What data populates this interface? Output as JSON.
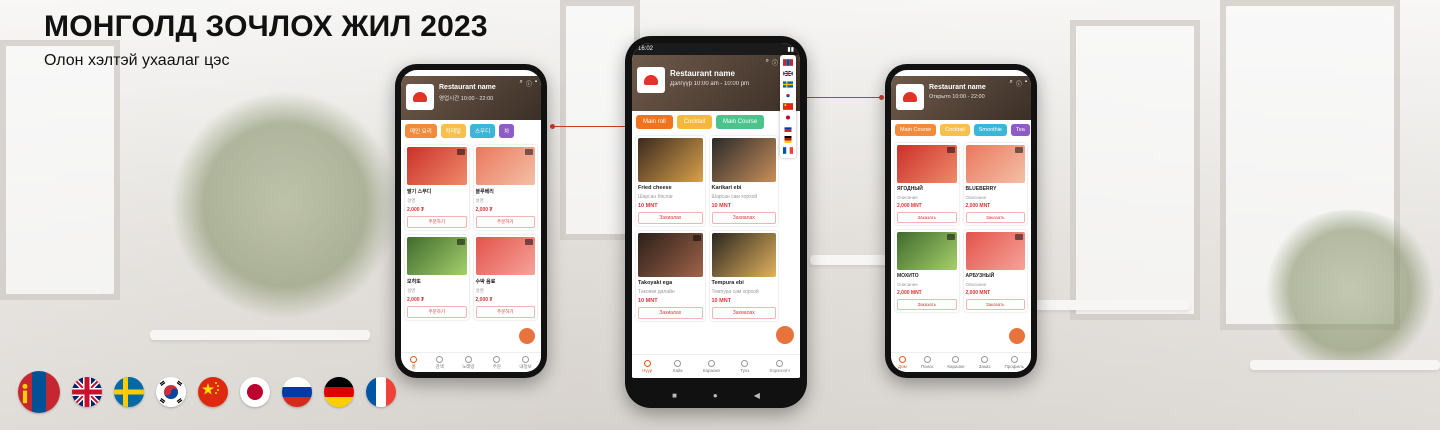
{
  "header": {
    "title": "МОНГОЛД ЗОЧЛОХ ЖИЛ 2023",
    "subtitle": "Олон хэлтэй ухаалаг цэс"
  },
  "colors": {
    "accent": "#e05a1e",
    "connector": "#d23a2a",
    "price": "#dd3333"
  },
  "flags": [
    "mn",
    "gb",
    "se",
    "kr",
    "cn",
    "jp",
    "ru",
    "de",
    "fr"
  ],
  "phones": {
    "left": {
      "restaurant_name": "Restaurant name",
      "hours": "영업시간 10:00 - 22:00",
      "tabs": [
        "메인 요리",
        "칵테일",
        "스무디",
        "차"
      ],
      "items": [
        {
          "name": "딸기 스무디",
          "desc": "설명",
          "price": "2,000 ₮",
          "button": "주문하기"
        },
        {
          "name": "블루베리",
          "desc": "설명",
          "price": "2,000 ₮",
          "button": "주문하기"
        },
        {
          "name": "모히또",
          "desc": "설명",
          "price": "2,000 ₮",
          "button": "주문하기"
        },
        {
          "name": "수박 음료",
          "desc": "설명",
          "price": "2,000 ₮",
          "button": "주문하기"
        }
      ],
      "nav": [
        "홈",
        "검색",
        "노래방",
        "주문",
        "내정보"
      ]
    },
    "center": {
      "time": "16:02",
      "restaurant_name": "Restaurant name",
      "hours": "Дэлгүүр 10:00 am - 10:00 pm",
      "tabs": [
        "Main roll",
        "Cocktail",
        "Main Course"
      ],
      "items": [
        {
          "name": "Fried cheese",
          "desc": "Шарсан бяслаг",
          "price": "10 MNT",
          "button": "Захиалах"
        },
        {
          "name": "Karikari ebi",
          "desc": "Шарсан сам хорхой",
          "price": "10 MNT",
          "button": "Захиалах"
        },
        {
          "name": "Takoyaki ega",
          "desc": "Такояки далайн",
          "price": "10 MNT",
          "button": "Захиалах"
        },
        {
          "name": "Tempura ebi",
          "desc": "Темпура сам хорхой",
          "price": "10 MNT",
          "button": "Захиалах"
        }
      ],
      "nav": [
        "Нүүр",
        "Хайх",
        "Караоке",
        "Тухз",
        "Хэрэглэгч"
      ],
      "languages": [
        "mn",
        "gb",
        "se",
        "kr",
        "cn",
        "jp",
        "ru",
        "de",
        "fr"
      ]
    },
    "right": {
      "restaurant_name": "Restaurant name",
      "hours": "Открыто 10:00 - 22:00",
      "tabs": [
        "Main Course",
        "Cocktail",
        "Smoothie",
        "Tea"
      ],
      "items": [
        {
          "name": "ЯГОДНЫЙ",
          "desc": "Описание",
          "price": "2,000 MNT",
          "button": "Заказать"
        },
        {
          "name": "BLUEBERRY",
          "desc": "Описание",
          "price": "2,000 MNT",
          "button": "Заказать"
        },
        {
          "name": "МОХИТО",
          "desc": "Описание",
          "price": "2,000 MNT",
          "button": "Заказать"
        },
        {
          "name": "АРБУЗНЫЙ",
          "desc": "Описание",
          "price": "2,000 MNT",
          "button": "Заказать"
        }
      ],
      "nav": [
        "Дом",
        "Поиск",
        "Караоке",
        "Заказ",
        "Профиль"
      ]
    }
  }
}
